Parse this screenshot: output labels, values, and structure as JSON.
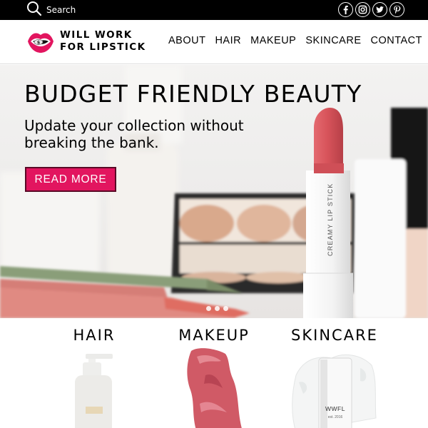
{
  "topbar": {
    "search_label": "Search",
    "search_icon": "search-icon",
    "socials": [
      "facebook-icon",
      "instagram-icon",
      "twitter-icon",
      "pinterest-icon"
    ]
  },
  "logo": {
    "line1": "WILL WORK",
    "line2": "FOR LIPSTICK",
    "mark_letter": "$"
  },
  "nav": {
    "items": [
      "ABOUT",
      "HAIR",
      "MAKEUP",
      "SKINCARE",
      "CONTACT"
    ]
  },
  "hero": {
    "title": "BUDGET FRIENDLY BEAUTY",
    "subtitle": "Update your collection without breaking the bank.",
    "button_label": "READ MORE",
    "lipstick_label": "CREAMY LIP STICK",
    "slide_count": 3
  },
  "categories": [
    {
      "title": "HAIR"
    },
    {
      "title": "MAKEUP"
    },
    {
      "title": "SKINCARE"
    }
  ],
  "skincare_bottle": {
    "brand": "WWFL",
    "est": "est. 2016"
  },
  "colors": {
    "accent": "#e2155f",
    "topbar": "#000000",
    "lipstick": "#d9545b"
  }
}
